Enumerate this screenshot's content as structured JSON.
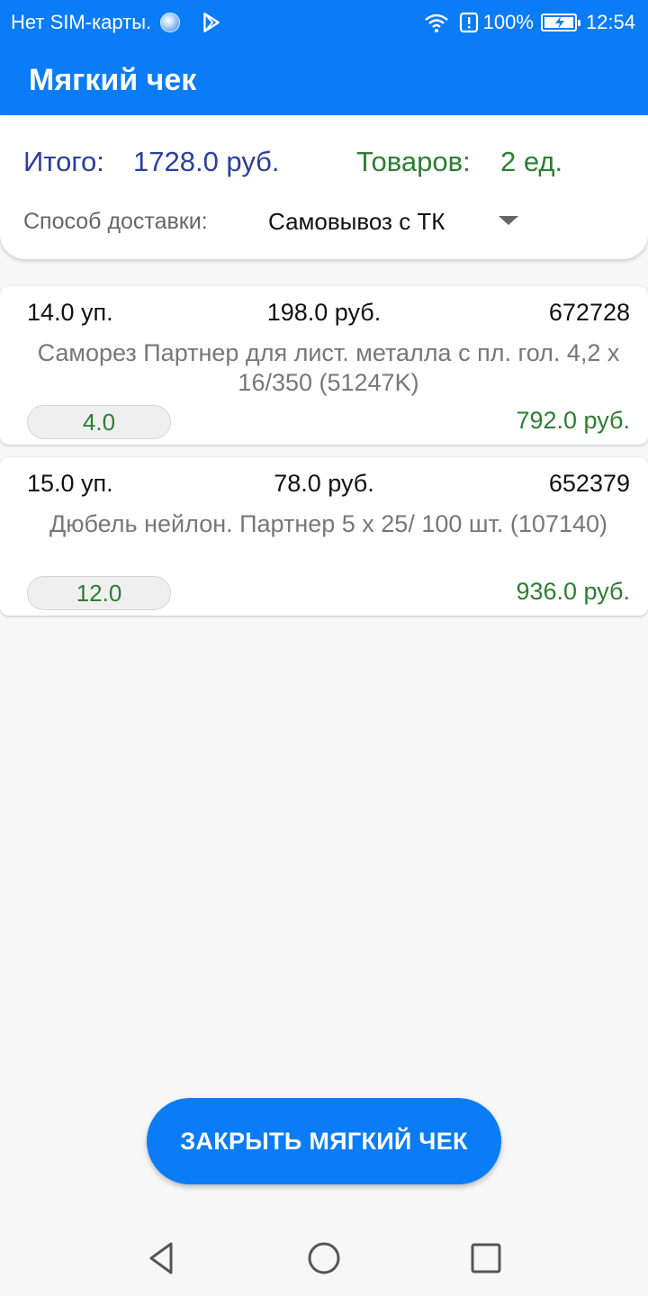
{
  "status_bar": {
    "carrier": "Нет SIM-карты.",
    "battery": "100%",
    "time": "12:54"
  },
  "app_bar": {
    "title": "Мягкий чек"
  },
  "summary": {
    "total_label": "Итого:",
    "total_value": "1728.0 руб.",
    "items_label": "Товаров:",
    "items_value": "2 ед.",
    "delivery_label": "Способ доставки:",
    "delivery_value": "Самовывоз с ТК"
  },
  "items": [
    {
      "qty": "14.0 уп.",
      "price": "198.0 руб.",
      "code": "672728",
      "name": "Саморез Партнер для лист. металла с пл. гол. 4,2 х 16/350 (51247K)",
      "count": "4.0",
      "sum": "792.0 руб."
    },
    {
      "qty": "15.0 уп.",
      "price": "78.0 руб.",
      "code": "652379",
      "name": "Дюбель  нейлон.  Партнер  5 х 25/ 100 шт. (107140)",
      "count": "12.0",
      "sum": "936.0 руб."
    }
  ],
  "actions": {
    "close_label": "ЗАКРЫТЬ МЯГКИЙ ЧЕК"
  },
  "colors": {
    "primary": "#0a7cf7",
    "total": "#2c3e9c",
    "green": "#2e7d32"
  },
  "icons": {
    "sync": "sync-dot-icon",
    "play": "play-store-icon",
    "wifi": "wifi-icon",
    "alert": "alert-icon",
    "battery": "battery-icon",
    "back": "back-icon",
    "home": "home-icon",
    "recents": "recents-icon"
  }
}
